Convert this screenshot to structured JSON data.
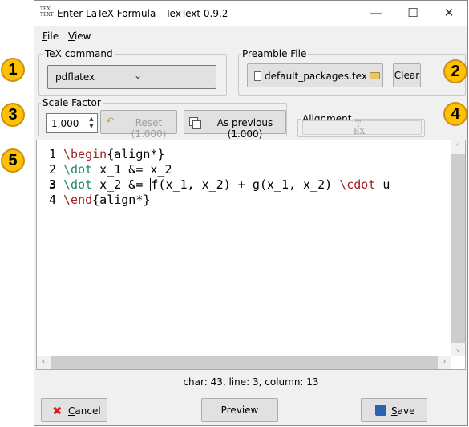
{
  "window": {
    "title": "Enter LaTeX Formula - TexText 0.9.2",
    "app_icon_top": "TEX",
    "app_icon_bottom": "TEXT",
    "controls": {
      "minimize": "—",
      "maximize": "☐",
      "close": "✕"
    }
  },
  "menu": [
    {
      "underline": "F",
      "rest": "ile"
    },
    {
      "underline": "V",
      "rest": "iew"
    }
  ],
  "tex_command": {
    "label": "TeX command",
    "value": "pdflatex",
    "arrow": "⌄"
  },
  "preamble": {
    "label": "Preamble File",
    "file": "default_packages.tex",
    "clear": "Clear"
  },
  "scale": {
    "label": "Scale Factor",
    "value": "1,000",
    "reset": "Reset (1.000)",
    "as_previous": "As previous (1.000)"
  },
  "alignment": {
    "label": "Alignment",
    "icon_top": "T",
    "icon_bottom": "EX"
  },
  "editor": {
    "lines": [
      {
        "num": "1",
        "parts": [
          {
            "t": "\\begin",
            "c": "kw"
          },
          {
            "t": "{align*}",
            "c": ""
          }
        ]
      },
      {
        "num": "2",
        "parts": [
          {
            "t": "\\dot",
            "c": "cm"
          },
          {
            "t": " x_1 &= x_2",
            "c": ""
          }
        ]
      },
      {
        "num": "3",
        "current": true,
        "parts": [
          {
            "t": "\\dot",
            "c": "cm"
          },
          {
            "t": " x_2 &= ",
            "c": ""
          },
          {
            "t": "",
            "c": "caret"
          },
          {
            "t": "f(x_1, x_2) + g(x_1, x_2) ",
            "c": ""
          },
          {
            "t": "\\cdot",
            "c": "kw"
          },
          {
            "t": " u",
            "c": ""
          }
        ]
      },
      {
        "num": "4",
        "parts": [
          {
            "t": "\\end",
            "c": "kw"
          },
          {
            "t": "{align*}",
            "c": ""
          }
        ]
      }
    ]
  },
  "status": "char: 43, line: 3, column: 13",
  "buttons": {
    "cancel_underline": "C",
    "cancel_rest": "ancel",
    "preview": "Preview",
    "save_underline": "S",
    "save_rest": "ave"
  },
  "badges": [
    "1",
    "2",
    "3",
    "4",
    "5"
  ],
  "colors": {
    "badge": "#ffc000",
    "keyword": "#a02020",
    "command": "#1f8a6a"
  }
}
